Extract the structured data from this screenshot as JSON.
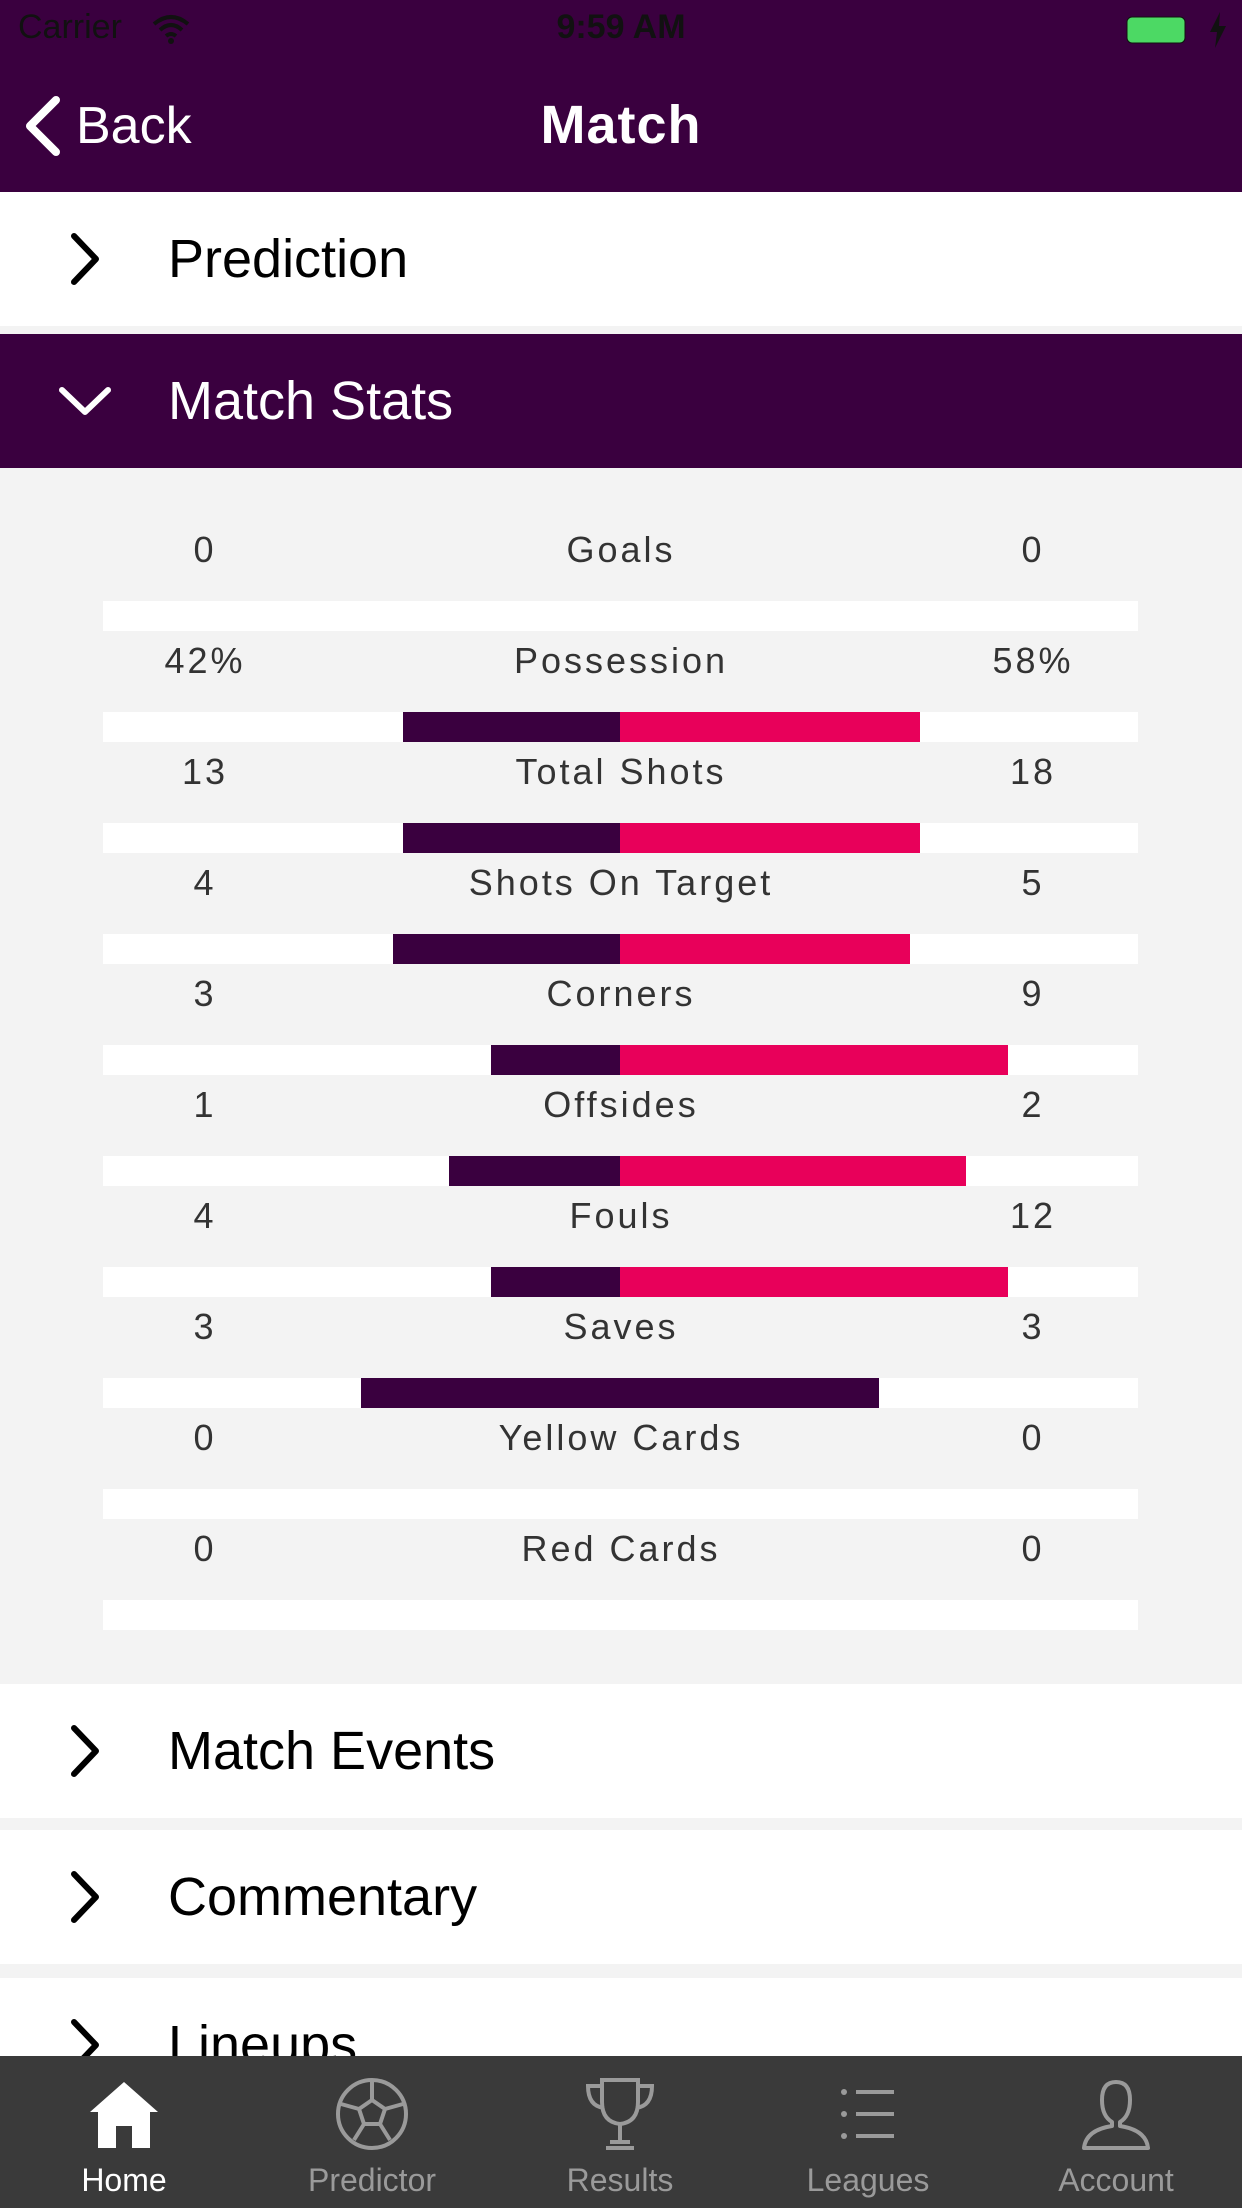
{
  "status_bar": {
    "carrier": "Carrier",
    "time": "9:59 AM"
  },
  "nav": {
    "back_label": "Back",
    "title": "Match"
  },
  "sections": {
    "prediction": "Prediction",
    "match_stats": "Match Stats",
    "match_events": "Match Events",
    "commentary": "Commentary",
    "lineups": "Lineups"
  },
  "stats": [
    {
      "name": "Goals",
      "home": "0",
      "away": "0",
      "home_bar": 0,
      "away_bar": 0
    },
    {
      "name": "Possession",
      "home": "42%",
      "away": "58%",
      "home_bar": 0.42,
      "away_bar": 0.58
    },
    {
      "name": "Total Shots",
      "home": "13",
      "away": "18",
      "home_bar": 0.42,
      "away_bar": 0.58
    },
    {
      "name": "Shots On Target",
      "home": "4",
      "away": "5",
      "home_bar": 0.44,
      "away_bar": 0.56
    },
    {
      "name": "Corners",
      "home": "3",
      "away": "9",
      "home_bar": 0.25,
      "away_bar": 0.75
    },
    {
      "name": "Offsides",
      "home": "1",
      "away": "2",
      "home_bar": 0.33,
      "away_bar": 0.67
    },
    {
      "name": "Fouls",
      "home": "4",
      "away": "12",
      "home_bar": 0.25,
      "away_bar": 0.75
    },
    {
      "name": "Saves",
      "home": "3",
      "away": "3",
      "home_bar": 0.5,
      "away_bar": 0.5
    },
    {
      "name": "Yellow Cards",
      "home": "0",
      "away": "0",
      "home_bar": 0,
      "away_bar": 0
    },
    {
      "name": "Red Cards",
      "home": "0",
      "away": "0",
      "home_bar": 0,
      "away_bar": 0
    }
  ],
  "tabs": [
    {
      "label": "Home",
      "icon": "home-icon",
      "active": true
    },
    {
      "label": "Predictor",
      "icon": "ball-icon",
      "active": false
    },
    {
      "label": "Results",
      "icon": "trophy-icon",
      "active": false
    },
    {
      "label": "Leagues",
      "icon": "list-icon",
      "active": false
    },
    {
      "label": "Account",
      "icon": "user-icon",
      "active": false
    }
  ],
  "colors": {
    "brand_purple": "#3a003f",
    "accent_pink": "#e8005a",
    "tab_bar": "#3a3a3a"
  }
}
